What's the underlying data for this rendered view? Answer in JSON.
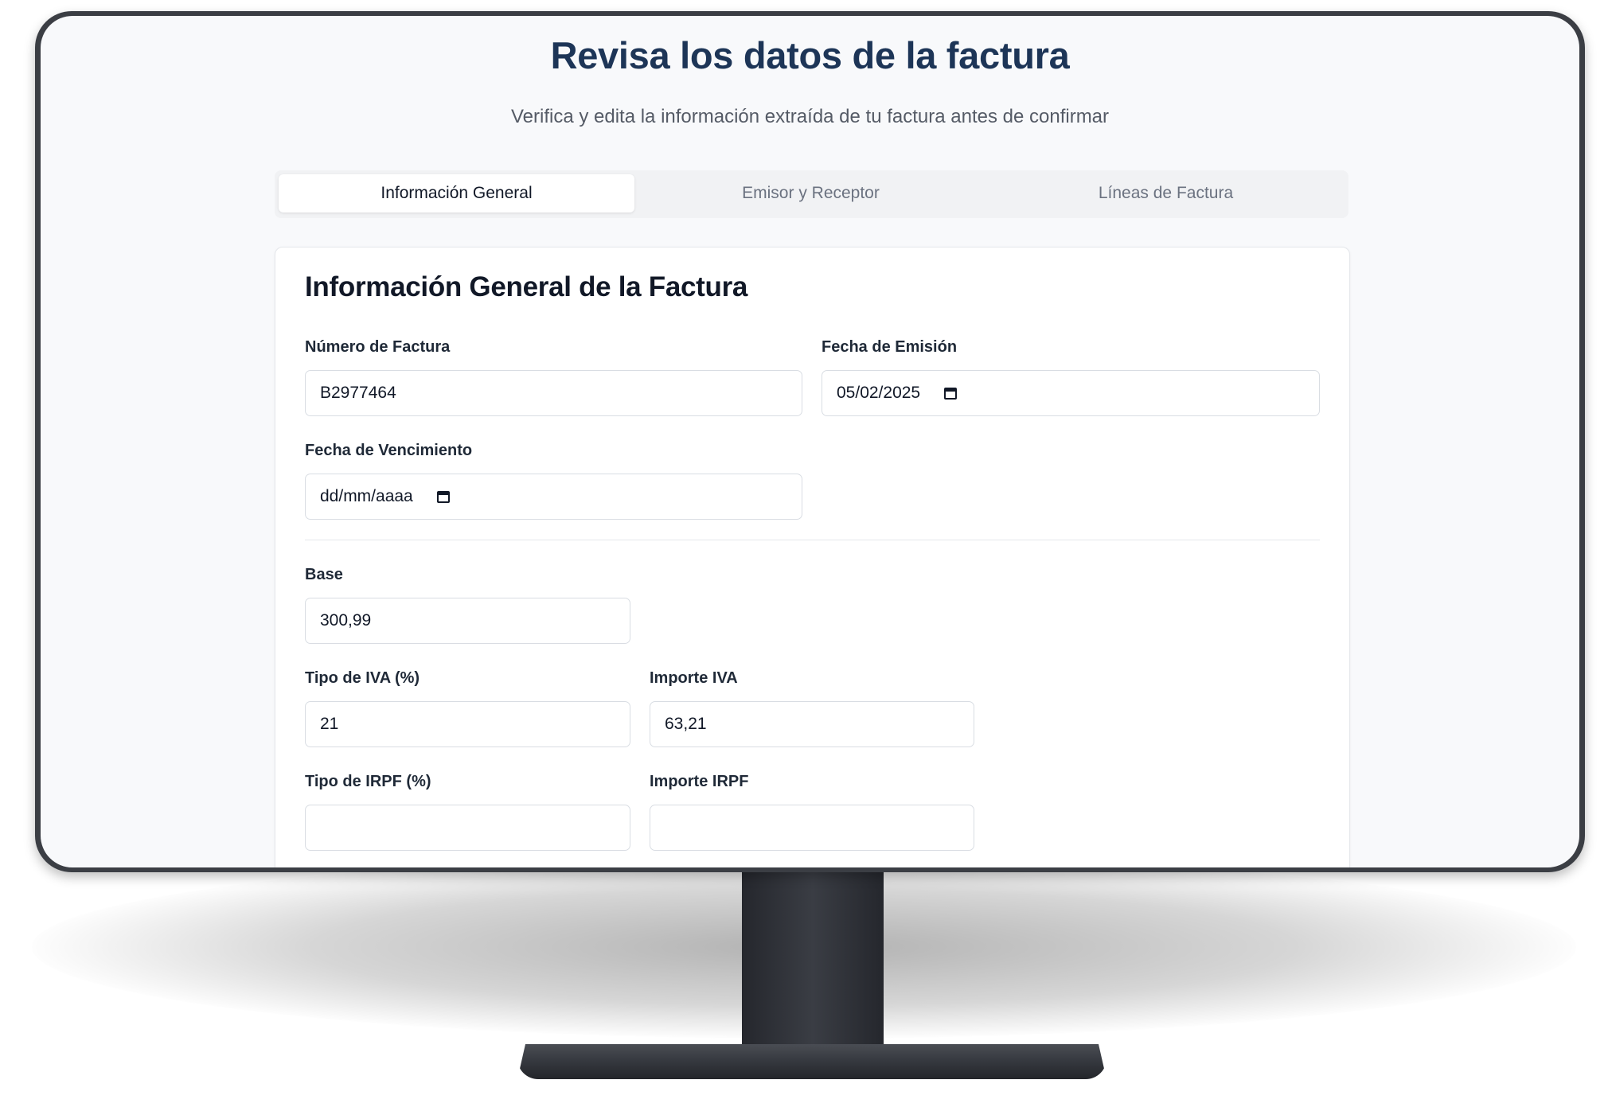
{
  "header": {
    "title": "Revisa los datos de la factura",
    "subtitle": "Verifica y edita la información extraída de tu factura antes de confirmar"
  },
  "tabs": [
    {
      "label": "Información General",
      "active": true
    },
    {
      "label": "Emisor y Receptor",
      "active": false
    },
    {
      "label": "Líneas de Factura",
      "active": false
    }
  ],
  "form": {
    "title": "Información General de la Factura",
    "invoice_number": {
      "label": "Número de Factura",
      "value": "B2977464"
    },
    "issue_date": {
      "label": "Fecha de Emisión",
      "value": "05/02/2025"
    },
    "due_date": {
      "label": "Fecha de Vencimiento",
      "value": "dd/mm/aaaa"
    },
    "base": {
      "label": "Base",
      "value": "300,99"
    },
    "vat_rate": {
      "label": "Tipo de IVA (%)",
      "value": "21"
    },
    "vat_amount": {
      "label": "Importe IVA",
      "value": "63,21"
    },
    "irpf_rate": {
      "label": "Tipo de IRPF (%)",
      "value": ""
    },
    "irpf_amount": {
      "label": "Importe IRPF",
      "value": ""
    }
  },
  "icons": {
    "date_picker": "calendar-icon"
  },
  "colors": {
    "title": "#1d3557",
    "screen_background": "#f8f9fb",
    "monitor": "#3b3e44"
  }
}
